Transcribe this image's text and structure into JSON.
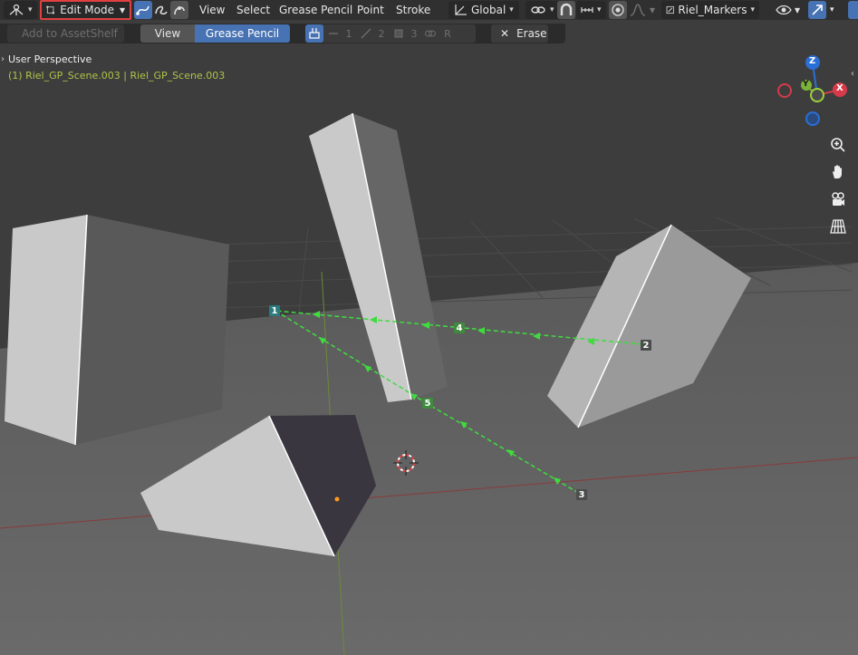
{
  "header": {
    "mode_label": "Edit Mode",
    "menus": [
      "View",
      "Select",
      "Grease Pencil",
      "Point",
      "Stroke"
    ],
    "transform_orientation": "Global",
    "object_name": "Riel_Markers"
  },
  "tool_settings": {
    "asset_shelf": "Add to AssetShelf",
    "tab_view": "View",
    "tab_grease_pencil": "Grease Pencil",
    "group_labels": [
      "1",
      "2",
      "3",
      "R"
    ],
    "erase_label": "Erase"
  },
  "viewport": {
    "title": "User Perspective",
    "subtitle": "(1) Riel_GP_Scene.003 | Riel_GP_Scene.003",
    "gizmo_axes": {
      "z": "Z",
      "y": "Y",
      "x": "X"
    },
    "markers": [
      {
        "label": "1"
      },
      {
        "label": "2"
      },
      {
        "label": "3"
      },
      {
        "label": "4"
      },
      {
        "label": "5"
      }
    ]
  },
  "colors": {
    "accent": "#4772b3",
    "stroke_green": "#3fdc3f",
    "highlight_red": "#e04040"
  }
}
